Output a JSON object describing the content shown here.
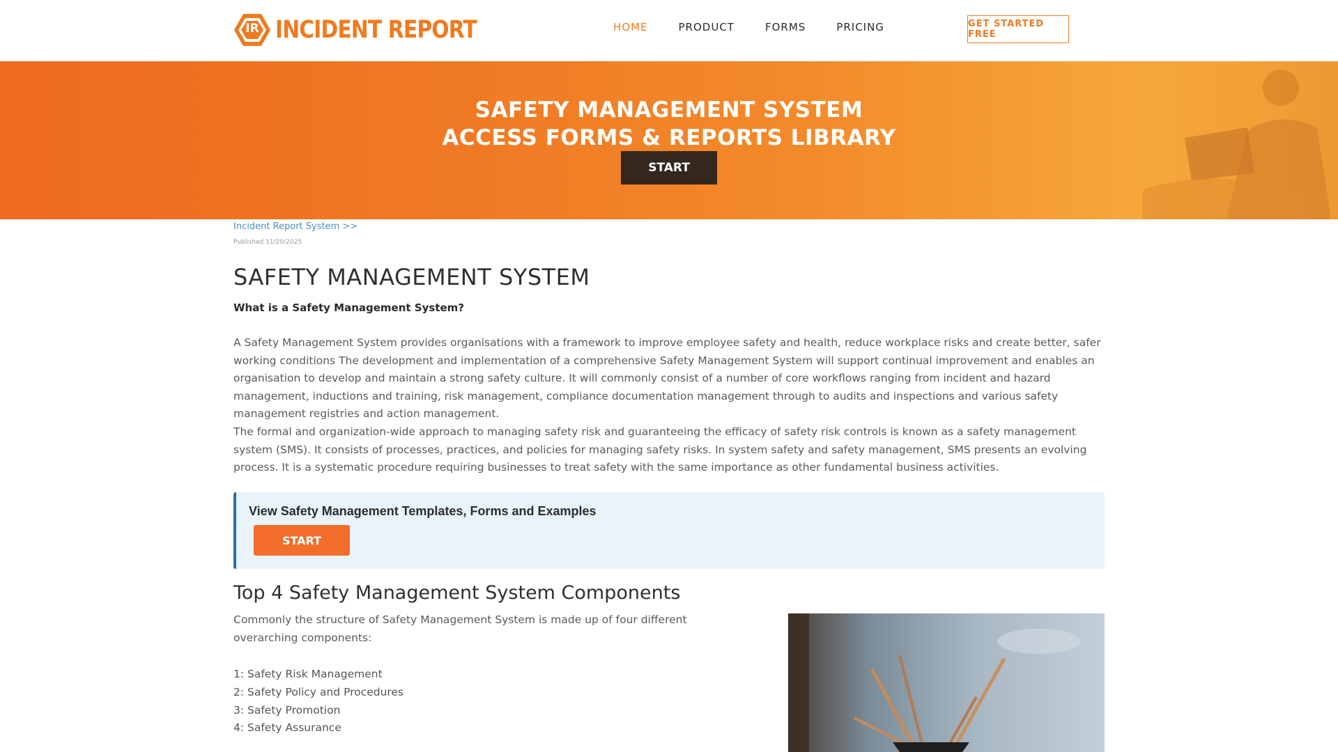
{
  "nav": {
    "logo_text": "INCIDENT REPORT",
    "logo_mark": "IR",
    "links": [
      "HOME",
      "PRODUCT",
      "FORMS",
      "PRICING"
    ],
    "active": "HOME",
    "cta": "GET STARTED FREE"
  },
  "hero": {
    "line1": "SAFETY MANAGEMENT SYSTEM",
    "line2": "ACCESS FORMS & REPORTS LIBRARY",
    "button": "START"
  },
  "breadcrumb": "Incident Report System >>",
  "published": "Published 11/20/2025",
  "article": {
    "title": "SAFETY MANAGEMENT SYSTEM",
    "question": "What is a Safety Management System?",
    "para1": "A Safety Management System provides organisations with a framework to improve employee safety and health, reduce workplace risks and create better, safer working conditions The development and implementation of a comprehensive Safety Management System will support continual improvement and enables an organisation to develop and maintain a strong safety culture. It will commonly consist of a number of core workflows ranging from incident and hazard management, inductions and training, risk management, compliance documentation management through to audits and inspections and various safety management registries and action management.",
    "para2": "The formal and organization-wide approach to managing safety risk and guaranteeing the efficacy of safety risk controls is known as a safety management system (SMS). It consists of processes, practices, and policies for managing safety risks. In system safety and safety management, SMS presents an evolving process. It is a systematic procedure requiring businesses to treat safety with the same importance as other fundamental business activities.",
    "callout_title": "View Safety Management Templates, Forms and Examples",
    "callout_button": "START",
    "h2": "Top 4 Safety Management System Components",
    "intro": "Commonly the structure of Safety Management System is made up of four different overarching components:",
    "components": [
      "1: Safety Risk Management",
      "2: Safety Policy and Procedures",
      "3: Safety Promotion",
      "4: Safety Assurance"
    ]
  },
  "colors": {
    "brand_orange": "#f07a1e",
    "dark_button": "#33271e",
    "callout_bg": "#e8f3fb",
    "callout_border": "#1f6fae",
    "link_blue": "#4a8fc4"
  }
}
